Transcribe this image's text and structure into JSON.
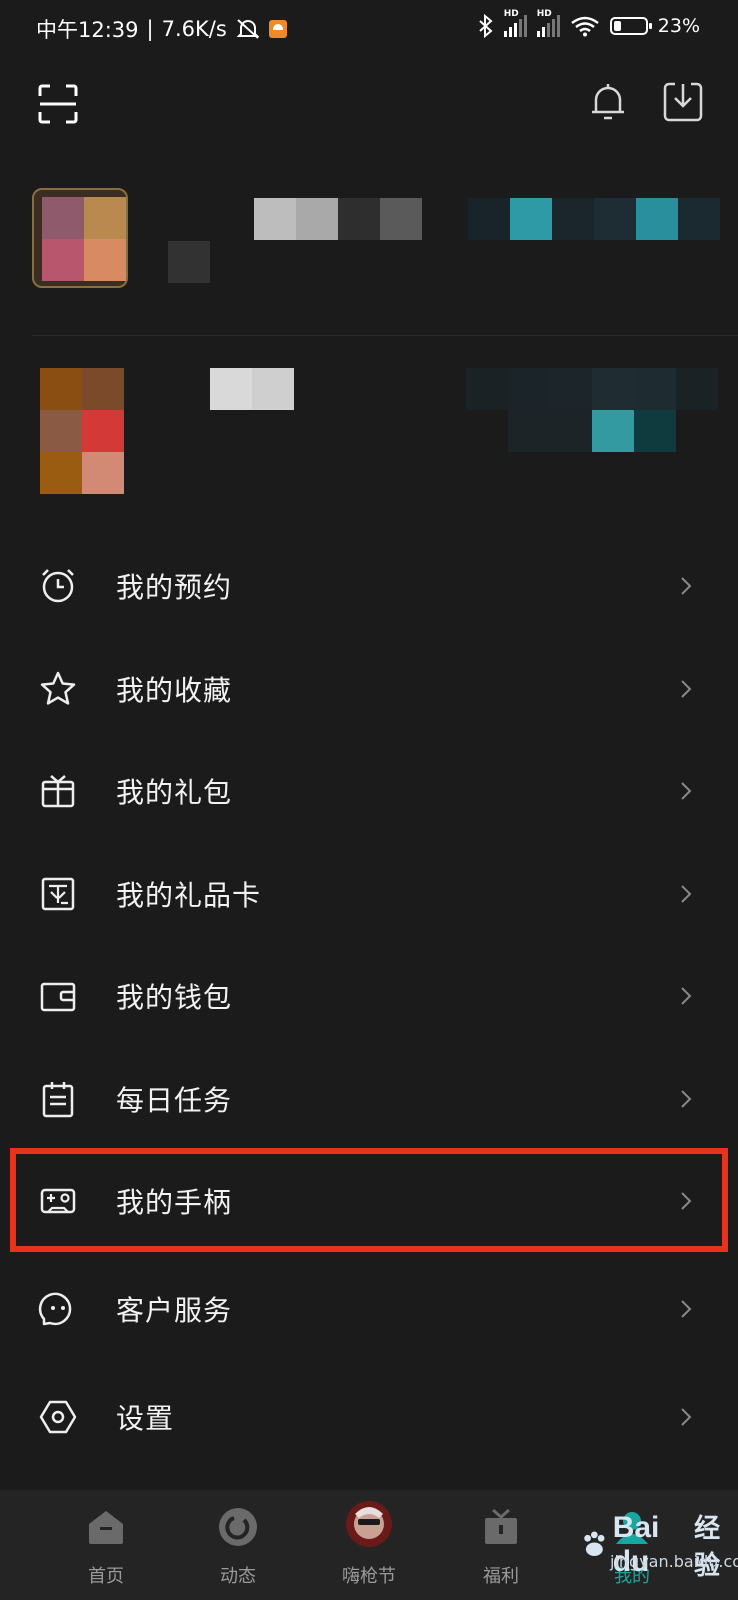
{
  "status_bar": {
    "time": "中午12:39",
    "speed": "7.6K/s",
    "hd1": "HD",
    "hd2": "HD",
    "battery_pct": "23%",
    "battery_level": 0.23
  },
  "menu": {
    "items": [
      {
        "label": "我的预约",
        "icon": "alarm-clock-icon"
      },
      {
        "label": "我的收藏",
        "icon": "star-icon"
      },
      {
        "label": "我的礼包",
        "icon": "gift-box-icon"
      },
      {
        "label": "我的礼品卡",
        "icon": "gift-card-icon"
      },
      {
        "label": "我的钱包",
        "icon": "wallet-icon"
      },
      {
        "label": "每日任务",
        "icon": "clipboard-icon"
      },
      {
        "label": "我的手柄",
        "icon": "gamepad-icon"
      },
      {
        "label": "客户服务",
        "icon": "customer-service-icon"
      },
      {
        "label": "设置",
        "icon": "settings-hexagon-icon"
      }
    ]
  },
  "bottom_nav": {
    "items": [
      {
        "label": "首页",
        "icon": "home-icon"
      },
      {
        "label": "动态",
        "icon": "feed-icon"
      },
      {
        "label": "嗨枪节",
        "icon": "avatar-icon"
      },
      {
        "label": "福利",
        "icon": "gift-icon"
      },
      {
        "label": "我的",
        "icon": "profile-icon"
      }
    ]
  },
  "watermark": {
    "brand": "Bai du",
    "text": "经验",
    "url": "jingyan.baidu.com"
  },
  "colors": {
    "background": "#1b1b1b",
    "highlight": "#e8321c",
    "nav_bg": "#242424"
  }
}
